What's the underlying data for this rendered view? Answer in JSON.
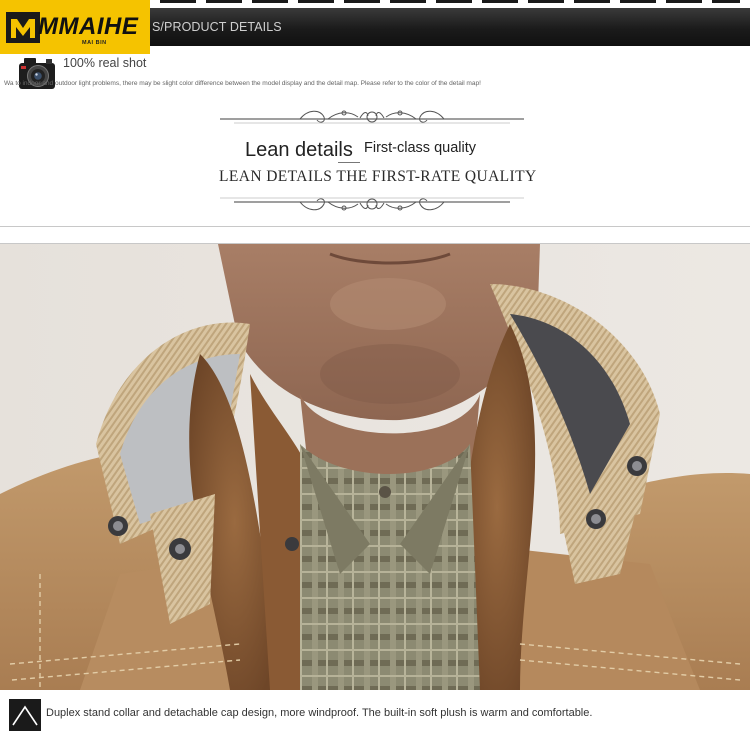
{
  "header": {
    "brand": "MMAIHE",
    "brand_sub": "MAI BIN",
    "section_title": "S/PRODUCT DETAILS"
  },
  "shot": {
    "label": "100% real shot",
    "disclaimer": "Wa                 to indoor and outdoor light problems, there may be slight color difference between the model display and the detail map. Please refer to the color of the detail map!"
  },
  "banner": {
    "title": "Lean details",
    "subtitle": "First-class quality",
    "caps": "LEAN DETAILS THE FIRST-RATE QUALITY"
  },
  "caption": {
    "text": "Duplex stand collar and detachable cap design, more windproof. The built-in soft plush is warm and comfortable."
  },
  "colors": {
    "logo_bg": "#f5c300",
    "header_bg": "#1b1b1b",
    "jacket_khaki": "#b8895c",
    "fur_brown": "#8a5a34"
  },
  "icons": {
    "camera": "camera-icon",
    "logo_mark": "m-logo-icon",
    "caption_mark": "triangle-icon"
  }
}
